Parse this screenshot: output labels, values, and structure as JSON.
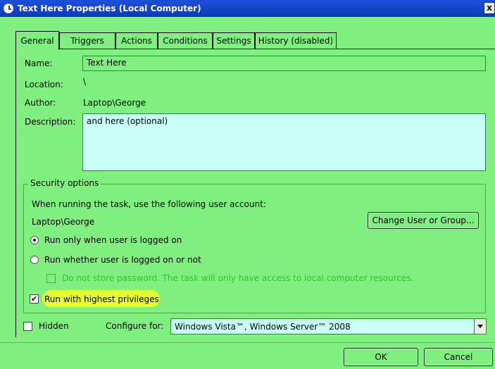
{
  "window": {
    "title": "Text Here Properties (Local Computer)",
    "close_label": "x"
  },
  "tabs": [
    {
      "label": "General",
      "active": true
    },
    {
      "label": "Triggers"
    },
    {
      "label": "Actions"
    },
    {
      "label": "Conditions"
    },
    {
      "label": "Settings"
    },
    {
      "label": "History (disabled)"
    }
  ],
  "general": {
    "name_label": "Name:",
    "name_value": "Text Here",
    "location_label": "Location:",
    "location_value": "\\",
    "author_label": "Author:",
    "author_value": "Laptop\\George",
    "description_label": "Description:",
    "description_value": "and here (optional)"
  },
  "security": {
    "group_title": "Security options",
    "account_prompt": "When running the task, use the following user account:",
    "account": "Laptop\\George",
    "change_user_button": "Change User or Group...",
    "run_logged_on": "Run only when user is logged on",
    "run_whether": "Run whether user is logged on or not",
    "do_not_store": "Do not store password.  The task will only have access to local computer resources.",
    "highest_privileges": "Run with highest privileges",
    "highest_privileges_checked": true
  },
  "footer": {
    "hidden_label": "Hidden",
    "hidden_checked": false,
    "configure_label": "Configure for:",
    "configure_value": "Windows Vista™, Windows Server™ 2008",
    "ok_button": "OK",
    "cancel_button": "Cancel"
  },
  "colors": {
    "background": "#7ff07f",
    "titlebar": "#0a3bb8",
    "highlight": "#e6ff2e",
    "field": "#c8fff8"
  }
}
